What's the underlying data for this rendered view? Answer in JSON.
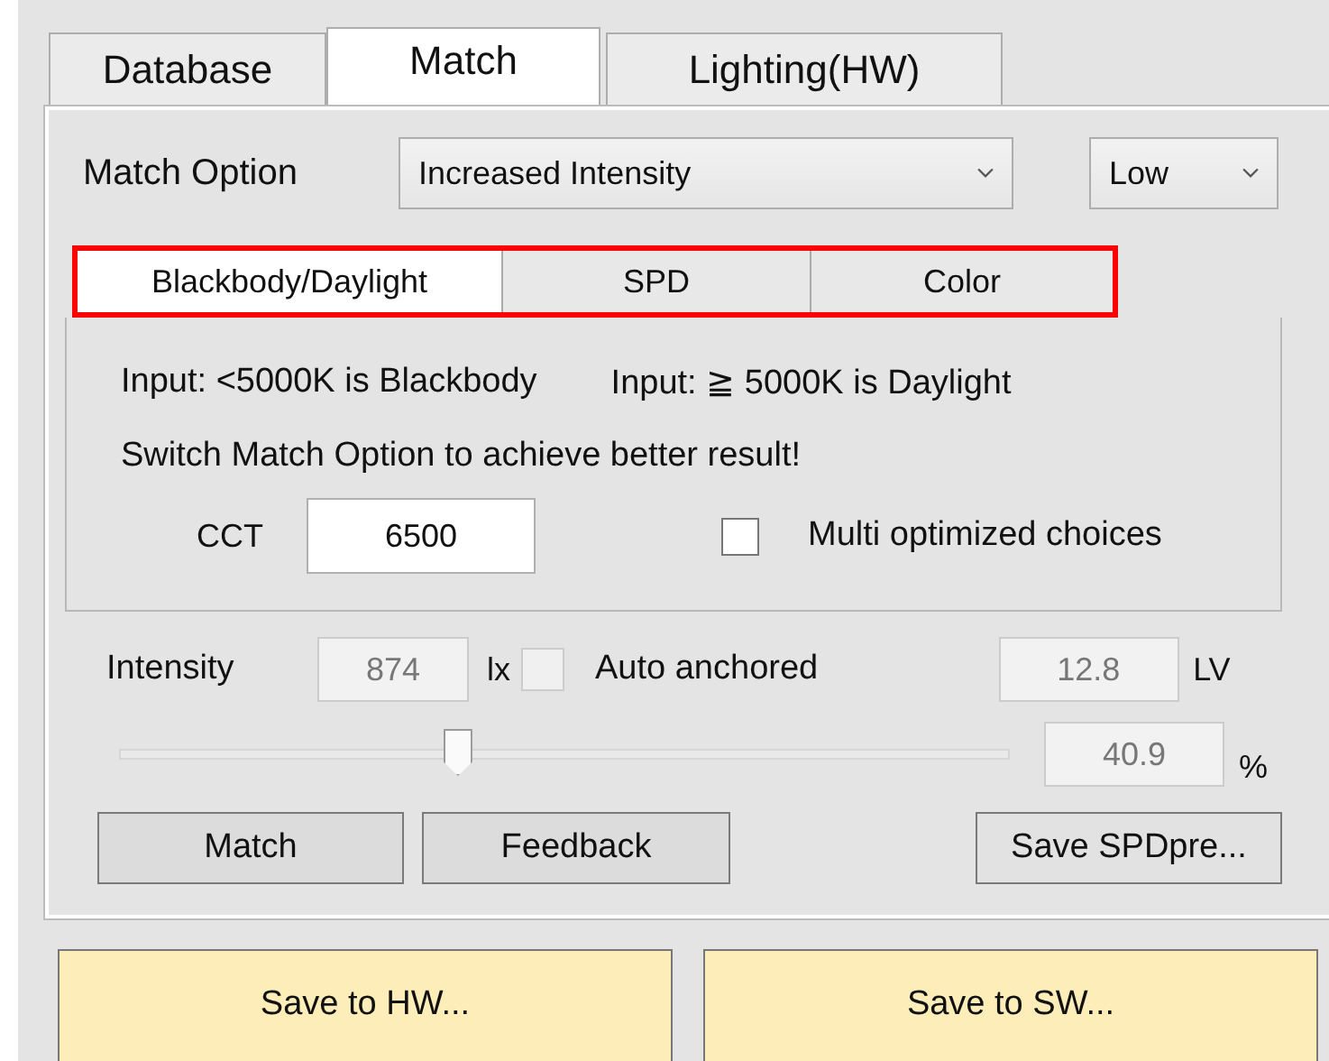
{
  "tabs": [
    {
      "label": "Database",
      "selected": false
    },
    {
      "label": "Match",
      "selected": true
    },
    {
      "label": "Lighting(HW)",
      "selected": false
    }
  ],
  "match_option": {
    "label": "Match Option",
    "value": "Increased Intensity",
    "level_value": "Low"
  },
  "sub_tabs": [
    {
      "label": "Blackbody/Daylight",
      "selected": true
    },
    {
      "label": "SPD",
      "selected": false
    },
    {
      "label": "Color",
      "selected": false
    }
  ],
  "info": {
    "line_1a": "Input: <5000K is Blackbody",
    "line_1b": "Input: ≧ 5000K is Daylight",
    "line_2": "Switch Match Option to achieve better result!"
  },
  "cct": {
    "label": "CCT",
    "value": "6500"
  },
  "multi": {
    "label": "Multi optimized choices",
    "checked": false
  },
  "intensity": {
    "label": "Intensity",
    "value": "874",
    "unit": "lx",
    "auto_label": "Auto anchored",
    "auto_checked": false,
    "lv_value": "12.8",
    "lv_unit": "LV",
    "level": 0.38,
    "percent_value": "40.9",
    "percent_unit": "%"
  },
  "buttons": [
    "Match",
    "Feedback",
    "Save SPDpre..."
  ],
  "bottom_buttons": [
    "Save to HW...",
    "Save to SW..."
  ]
}
